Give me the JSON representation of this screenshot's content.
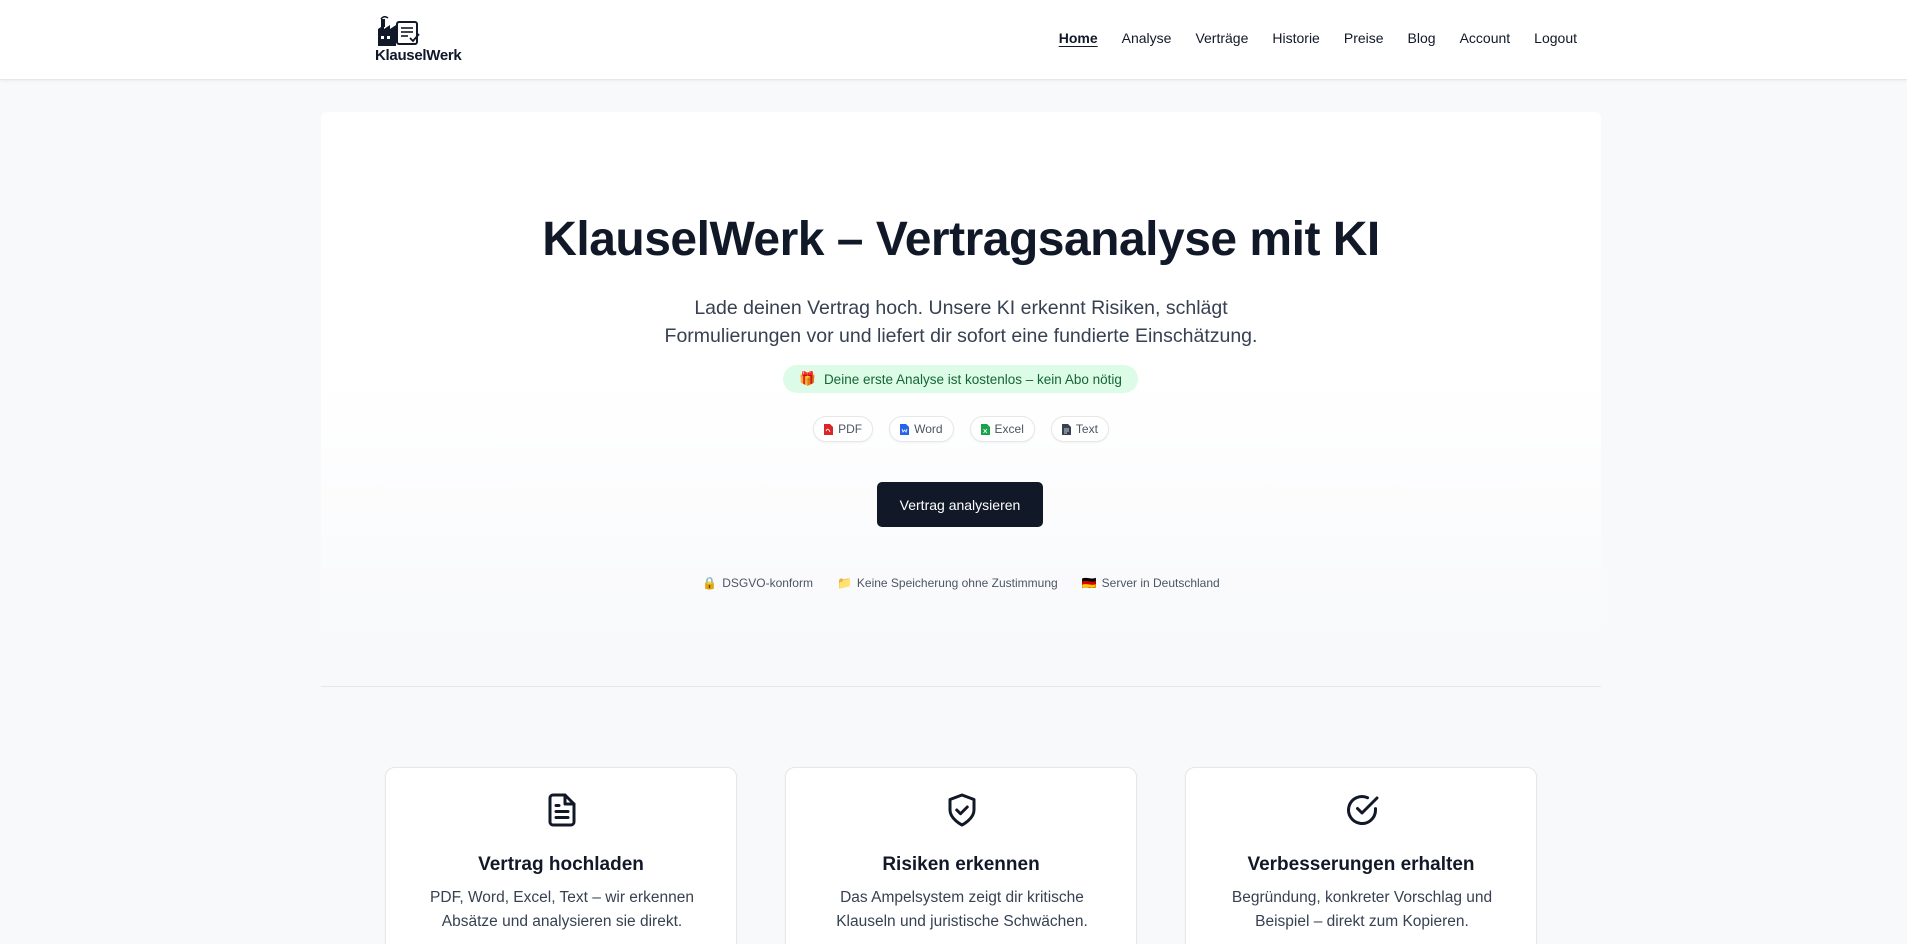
{
  "header": {
    "logo_text": "KlauselWerk",
    "nav": [
      {
        "label": "Home",
        "active": true
      },
      {
        "label": "Analyse"
      },
      {
        "label": "Verträge"
      },
      {
        "label": "Historie"
      },
      {
        "label": "Preise"
      },
      {
        "label": "Blog"
      },
      {
        "label": "Account"
      },
      {
        "label": "Logout"
      }
    ]
  },
  "hero": {
    "title": "KlauselWerk – Vertragsanalyse mit KI",
    "subtitle": "Lade deinen Vertrag hoch. Unsere KI erkennt Risiken, schlägt Formulierungen vor und liefert dir sofort eine fundierte Einschätzung.",
    "promo_icon": "🎁",
    "promo_text": "Deine erste Analyse ist kostenlos – kein Abo nötig",
    "formats": [
      {
        "label": "PDF",
        "icon": "pdf-file-icon",
        "color": "#dc2626"
      },
      {
        "label": "Word",
        "icon": "word-file-icon",
        "color": "#2563eb"
      },
      {
        "label": "Excel",
        "icon": "excel-file-icon",
        "color": "#16a34a"
      },
      {
        "label": "Text",
        "icon": "text-file-icon",
        "color": "#374151"
      }
    ],
    "cta_label": "Vertrag analysieren",
    "trust": [
      {
        "icon": "🔒",
        "label": "DSGVO-konform"
      },
      {
        "icon": "📁",
        "label": "Keine Speicherung ohne Zustimmung"
      },
      {
        "icon": "🇩🇪",
        "label": "Server in Deutschland"
      }
    ]
  },
  "features": [
    {
      "icon": "document-icon",
      "title": "Vertrag hochladen",
      "text": "PDF, Word, Excel, Text – wir erkennen Absätze und analysieren sie direkt."
    },
    {
      "icon": "shield-check-icon",
      "title": "Risiken erkennen",
      "text": "Das Ampelsystem zeigt dir kritische Klauseln und juristische Schwächen."
    },
    {
      "icon": "check-circle-icon",
      "title": "Verbesserungen erhalten",
      "text": "Begründung, konkreter Vorschlag und Beispiel – direkt zum Kopieren."
    }
  ],
  "colors": {
    "primary": "#111827",
    "promo_bg": "#dcfce7",
    "promo_text": "#166534"
  }
}
